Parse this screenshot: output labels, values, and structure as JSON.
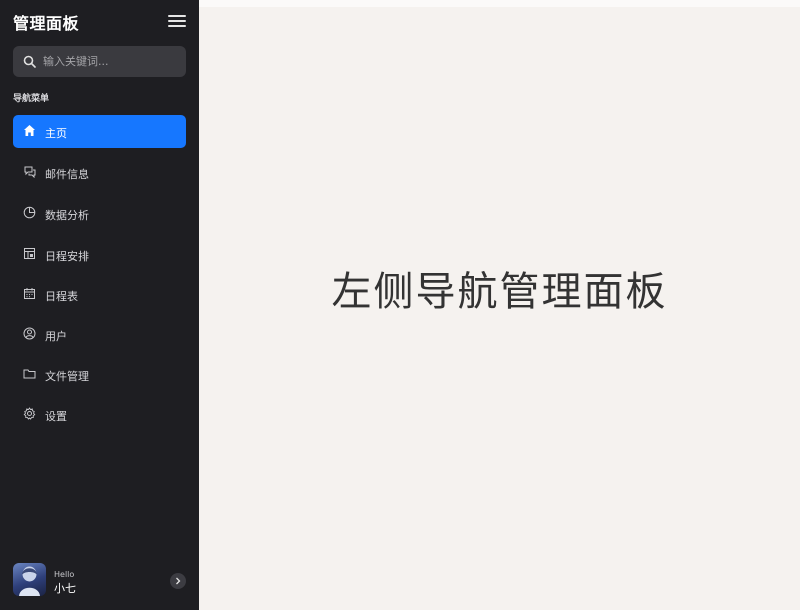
{
  "sidebar": {
    "brand": "管理面板",
    "search": {
      "placeholder": "输入关键词..."
    },
    "section_label": "导航菜单",
    "items": [
      {
        "label": "主页",
        "icon": "home-icon",
        "active": true
      },
      {
        "label": "邮件信息",
        "icon": "chat-icon",
        "active": false
      },
      {
        "label": "数据分析",
        "icon": "pie-chart-icon",
        "active": false
      },
      {
        "label": "日程安排",
        "icon": "schedule-icon",
        "active": false
      },
      {
        "label": "日程表",
        "icon": "calendar-icon",
        "active": false
      },
      {
        "label": "用户",
        "icon": "user-icon",
        "active": false
      },
      {
        "label": "文件管理",
        "icon": "folder-icon",
        "active": false
      },
      {
        "label": "设置",
        "icon": "settings-icon",
        "active": false
      }
    ],
    "footer": {
      "greeting": "Hello",
      "username": "小七"
    }
  },
  "main": {
    "title": "左侧导航管理面板"
  },
  "colors": {
    "sidebar_bg": "#1e1e22",
    "accent": "#1677ff",
    "main_bg": "#f5f2ef"
  }
}
